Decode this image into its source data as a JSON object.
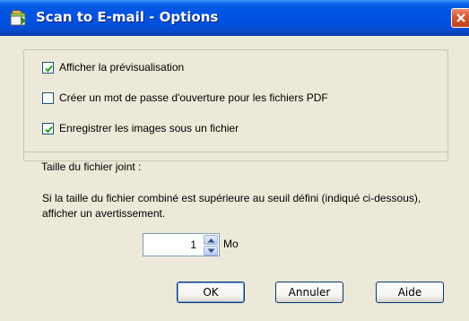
{
  "window": {
    "title": "Scan to E-mail - Options"
  },
  "options": [
    {
      "label": "Afficher la prévisualisation",
      "checked": true
    },
    {
      "label": "Créer un mot de passe d'ouverture pour les fichiers PDF",
      "checked": false
    },
    {
      "label": "Enregistrer les images sous un fichier",
      "checked": true
    }
  ],
  "attachment": {
    "section_label": "Taille du fichier joint :",
    "description": "Si la taille du fichier combiné est supérieure au seuil défini (indiqué ci-dessous), afficher un avertissement.",
    "threshold_value": "1",
    "unit": "Mo"
  },
  "buttons": {
    "ok": "OK",
    "cancel": "Annuler",
    "help": "Aide"
  },
  "colors": {
    "titlebar": "#0054e3",
    "dialog_bg": "#ece9d8",
    "check_mark": "#21a121"
  },
  "icons": {
    "title": "scanner-mail-icon",
    "close": "close-icon",
    "check": "check-icon"
  }
}
